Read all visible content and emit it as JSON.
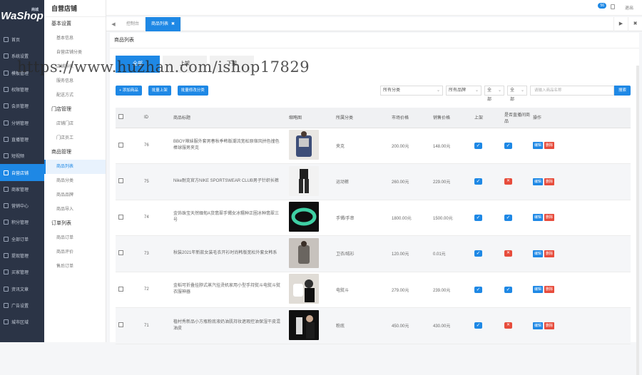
{
  "logo": {
    "text": "WaShop",
    "tag": "商城"
  },
  "nav": [
    "首页",
    "系统设置",
    "模板管理",
    "权限管理",
    "会员管理",
    "分销管理",
    "直播管理",
    "短视频",
    "自营店铺",
    "商家管理",
    "营销中心",
    "积分管理",
    "全部订单",
    "提现管理",
    "买家管理",
    "资讯文章",
    "广告设置",
    "城市区域"
  ],
  "sub": {
    "title": "自营店铺",
    "groups": [
      {
        "label": "基本设置",
        "items": [
          "基本信息",
          "自营店铺分类",
          "店铺导航",
          "服务信息",
          "配送方式"
        ]
      },
      {
        "label": "门店管理",
        "items": [
          "店铺门店",
          "门店员工"
        ]
      },
      {
        "label": "商品管理",
        "items": [
          "商品列表",
          "商品分类",
          "商品品牌",
          "商品导入"
        ]
      },
      {
        "label": "订单列表",
        "items": [
          "商品订单",
          "商品评价",
          "售后订单"
        ]
      }
    ]
  },
  "topbar": {
    "badge": "56",
    "exit": "退出"
  },
  "tabs": {
    "prev": "◀",
    "home": "控制台",
    "active": "商品列表",
    "close": "✖",
    "next": "▶",
    "close_all": "✖"
  },
  "page": {
    "title": "商品列表",
    "subtabs": [
      "全部",
      "上架",
      "下架"
    ],
    "watermark": "https://www.huzhan.com/ishop17829",
    "buttons": [
      "+ 添加商品",
      "批量上架",
      "批量修改分类"
    ],
    "filters": {
      "category": "所有分类",
      "brand": "所有品牌",
      "status1": "全部",
      "status2": "全部",
      "search_placeholder": "请输入商品名称",
      "search_btn": "搜索"
    }
  },
  "table": {
    "headers": [
      "",
      "ID",
      "商品标题",
      "缩略图",
      "所属分类",
      "市场价格",
      "销售价格",
      "上架",
      "是否直播间商品",
      "操作"
    ],
    "edit": "编辑",
    "delete": "删除",
    "rows": [
      {
        "id": "76",
        "title": "BBOY辣妹服外套男春秋季韩版潮流宽松原宿风拼色撞色棒球服男夹克",
        "category": "夹克",
        "market": "200.00元",
        "sale": "148.00元",
        "onsale": true,
        "live": true
      },
      {
        "id": "75",
        "title": "Nike耐克官方NIKE SPORTSWEAR CLUB男子针织长裤",
        "category": "运动裤",
        "market": "260.00元",
        "sale": "229.00元",
        "onsale": true,
        "live": false
      },
      {
        "id": "74",
        "title": "金饰珠宝天然缅甸A货翡翠手镯女冰糯种正圈冰种翡翠三号",
        "category": "手镯/手串",
        "market": "1800.00元",
        "sale": "1500.00元",
        "onsale": true,
        "live": true
      },
      {
        "id": "73",
        "title": "秋装2021年新款女装毛衣开衫时尚韩版宽松外套女韩系",
        "category": "卫衣/绒衫",
        "market": "120.00元",
        "sale": "0.01元",
        "onsale": true,
        "live": false
      },
      {
        "id": "72",
        "title": "金稻可折叠挂脖式蒸汽挂烫机家用小型手持熨斗电熨斗熨衣服神器",
        "category": "电熨斗",
        "market": "279.00元",
        "sale": "239.00元",
        "onsale": true,
        "live": true
      },
      {
        "id": "71",
        "title": "植村秀新品小方瓶粉底液奶油肌持妆遮瑕控油保湿干皮混油皮",
        "category": "粉底",
        "market": "450.00元",
        "sale": "430.00元",
        "onsale": true,
        "live": false
      }
    ]
  }
}
